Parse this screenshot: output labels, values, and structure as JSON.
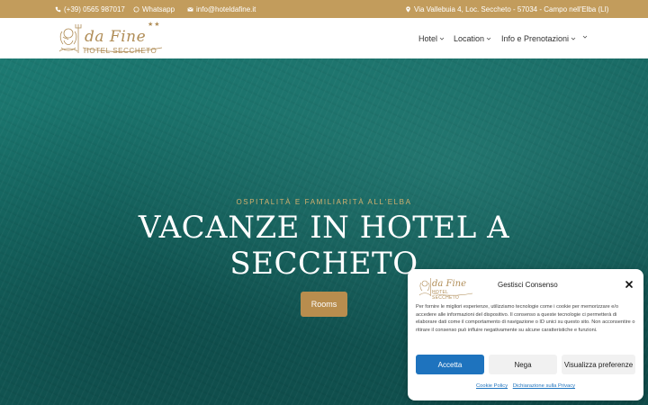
{
  "topbar": {
    "phone": "(+39) 0565 987017",
    "whatsapp": "Whatsapp",
    "email": "info@hoteldafine.it",
    "address": "Via Vallebuia 4, Loc. Seccheto - 57034 - Campo nell'Elba (LI)"
  },
  "logo": {
    "script": "da Fine",
    "name": "HOTEL SECCHETO",
    "stars": "★★"
  },
  "nav": {
    "items": [
      {
        "label": "Hotel"
      },
      {
        "label": "Location"
      },
      {
        "label": "Info e Prenotazioni"
      }
    ]
  },
  "hero": {
    "subtitle": "OSPITALITÀ E FAMILIARITÀ ALL'ELBA",
    "title_line1": "VACANZE IN HOTEL A",
    "title_line2": "SECCHETO",
    "button": "Rooms"
  },
  "consent": {
    "logo_script": "da Fine",
    "logo_name": "HOTEL SECCHETO",
    "title": "Gestisci Consenso",
    "text": "Per fornire le migliori esperienze, utilizziamo tecnologie come i cookie per memorizzare e/o accedere alle informazioni del dispositivo. Il consenso a queste tecnologie ci permetterà di elaborare dati come il comportamento di navigazione o ID unici su questo sito. Non acconsentire o ritirare il consenso può influire negativamente su alcune caratteristiche e funzioni.",
    "accept": "Accetta",
    "deny": "Nega",
    "preferences": "Visualizza preferenze",
    "cookie_policy": "Cookie Policy",
    "privacy": "Dichiarazione sulla Privacy"
  },
  "colors": {
    "gold": "#c29c5c",
    "accent_blue": "#1e73be",
    "sea": "#1d7a72"
  }
}
